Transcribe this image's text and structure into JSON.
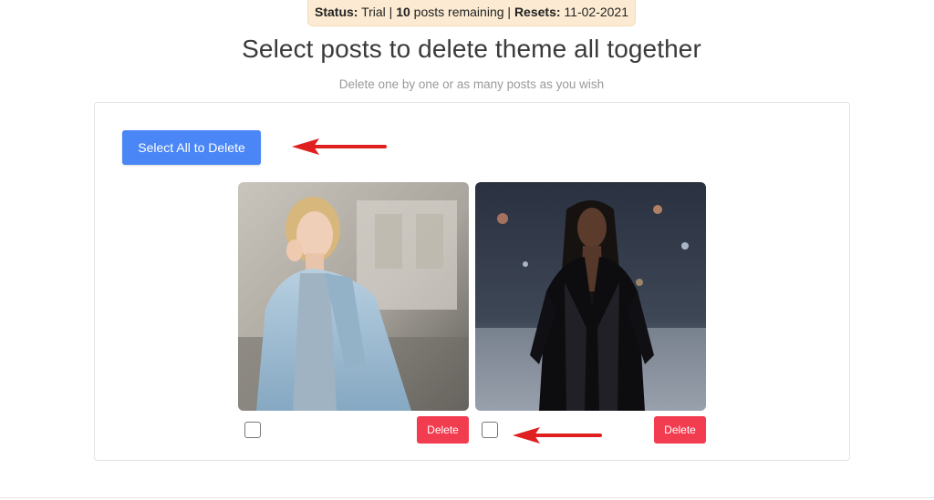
{
  "status": {
    "status_label": "Status:",
    "status_value": " Trial",
    "separator_1": "  | ",
    "posts_count": "10",
    "posts_text": " posts remaining | ",
    "resets_label": "Resets:",
    "resets_value": " 11-02-2021"
  },
  "header": {
    "title": "Select posts to delete theme all together",
    "subtitle": "Delete one by one or as many posts as you wish"
  },
  "actions": {
    "select_all_label": "Select All to Delete"
  },
  "posts": [
    {
      "delete_label": "Delete",
      "checked": false
    },
    {
      "delete_label": "Delete",
      "checked": false
    }
  ],
  "colors": {
    "primary": "#4a86f5",
    "danger": "#f23c50",
    "annotation_arrow": "#e02020",
    "status_bg": "#fcebd2"
  }
}
